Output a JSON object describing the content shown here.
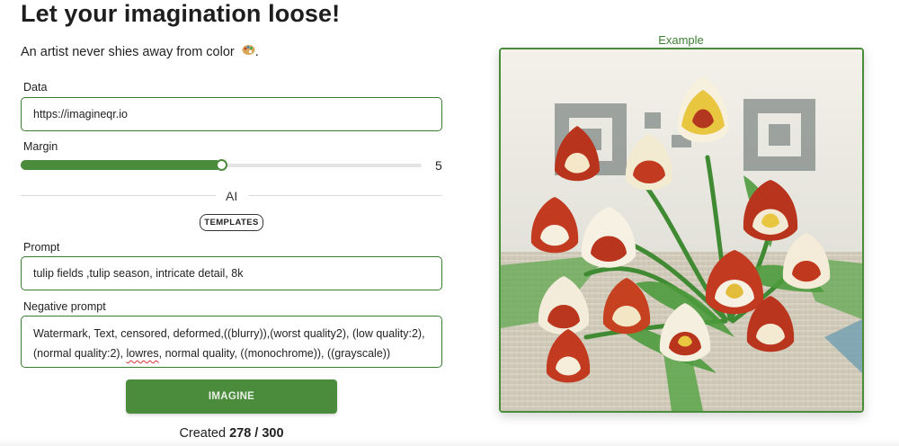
{
  "header": {
    "title": "Let your imagination loose!",
    "subtitle": "An artist never shies away from color",
    "subtitle_suffix": "."
  },
  "form": {
    "data_label": "Data",
    "data_value": "https://imagineqr.io",
    "margin_label": "Margin",
    "margin_value": "5",
    "margin_fraction": 0.5,
    "divider_label": "AI",
    "templates_label": "TEMPLATES",
    "prompt_label": "Prompt",
    "prompt_value": "tulip fields ,tulip season, intricate detail, 8k",
    "negative_label": "Negative prompt",
    "negative_value_part1": "Watermark, Text, censored, deformed,((blurry)),(worst quality2), (low quality:2),",
    "negative_value_part2": "(normal quality:2), ",
    "negative_value_lowres": "lowres",
    "negative_value_part3": ", normal quality, ((monochrome)), ((grayscale))",
    "imagine_label": "IMAGINE"
  },
  "status": {
    "created_prefix": "Created ",
    "created_count": "278 / 300"
  },
  "example": {
    "label": "Example",
    "image_icon": "tulip-bouquet-qr-image"
  },
  "colors": {
    "accent": "#4a8b3c",
    "accent_text": "#3f7f35"
  }
}
